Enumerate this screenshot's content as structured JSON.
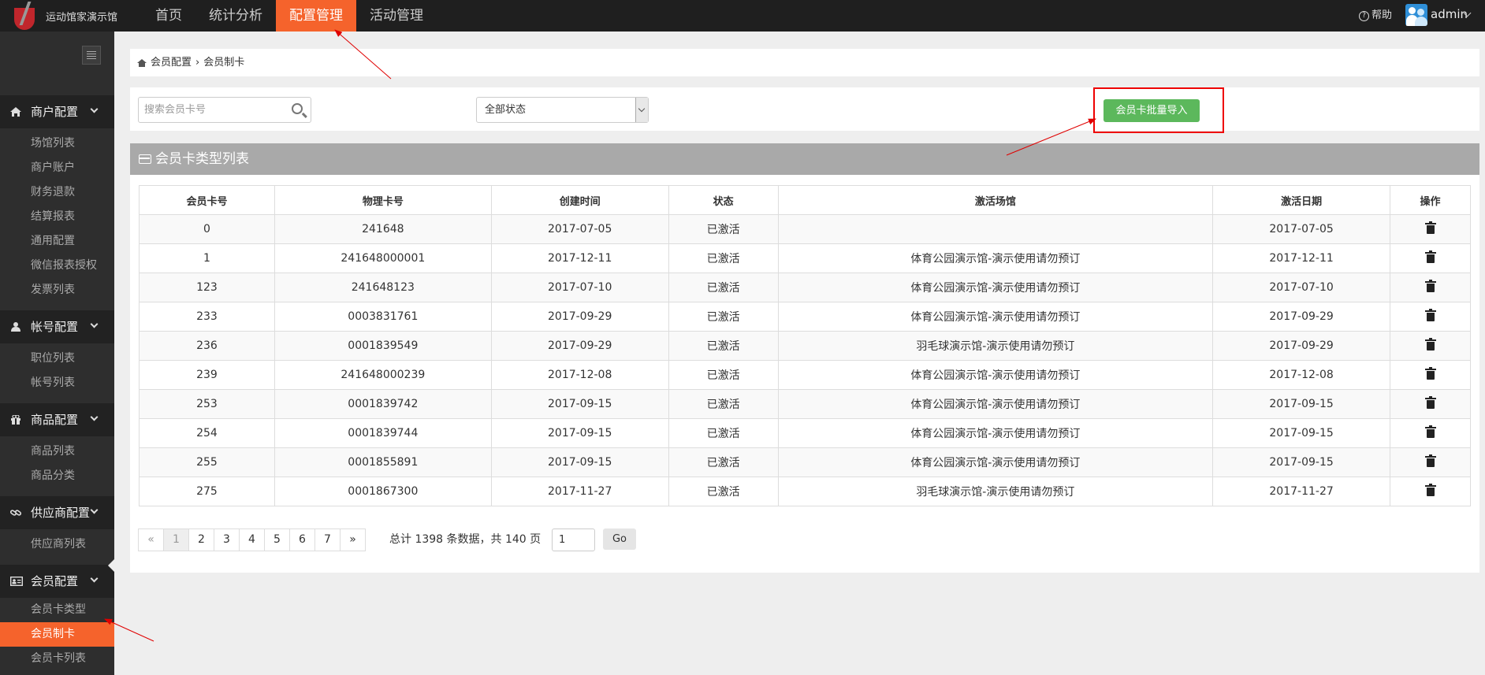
{
  "app": {
    "logo_text": "运动馆家演示馆",
    "help": "帮助",
    "user": "admin"
  },
  "nav": [
    {
      "label": "首页"
    },
    {
      "label": "统计分析"
    },
    {
      "label": "配置管理",
      "active": true
    },
    {
      "label": "活动管理"
    }
  ],
  "sidebar": {
    "sections": [
      {
        "label": "商户配置",
        "icon": "home-icon",
        "items": [
          "场馆列表",
          "商户账户",
          "财务退款",
          "结算报表",
          "通用配置",
          "微信报表授权",
          "发票列表"
        ]
      },
      {
        "label": "帐号配置",
        "icon": "user-icon",
        "items": [
          "职位列表",
          "帐号列表"
        ]
      },
      {
        "label": "商品配置",
        "icon": "gift-icon",
        "items": [
          "商品列表",
          "商品分类"
        ]
      },
      {
        "label": "供应商配置",
        "icon": "link-icon",
        "items": [
          "供应商列表"
        ]
      },
      {
        "label": "会员配置",
        "icon": "id-card-icon",
        "items": [
          "会员卡类型",
          "会员制卡",
          "会员卡列表"
        ]
      }
    ],
    "active_item": "会员制卡"
  },
  "breadcrumb": {
    "parent": "会员配置",
    "separator": "›",
    "current": "会员制卡"
  },
  "filter": {
    "search_placeholder": "搜索会员卡号",
    "status_value": "全部状态",
    "import_label": "会员卡批量导入"
  },
  "panel": {
    "title": "会员卡类型列表"
  },
  "table": {
    "headers": [
      "会员卡号",
      "物理卡号",
      "创建时间",
      "状态",
      "激活场馆",
      "激活日期",
      "操作"
    ],
    "rows": [
      [
        "0",
        "241648",
        "2017-07-05",
        "已激活",
        "",
        "2017-07-05"
      ],
      [
        "1",
        "241648000001",
        "2017-12-11",
        "已激活",
        "体育公园演示馆-演示使用请勿预订",
        "2017-12-11"
      ],
      [
        "123",
        "241648123",
        "2017-07-10",
        "已激活",
        "体育公园演示馆-演示使用请勿预订",
        "2017-07-10"
      ],
      [
        "233",
        "0003831761",
        "2017-09-29",
        "已激活",
        "体育公园演示馆-演示使用请勿预订",
        "2017-09-29"
      ],
      [
        "236",
        "0001839549",
        "2017-09-29",
        "已激活",
        "羽毛球演示馆-演示使用请勿预订",
        "2017-09-29"
      ],
      [
        "239",
        "241648000239",
        "2017-12-08",
        "已激活",
        "体育公园演示馆-演示使用请勿预订",
        "2017-12-08"
      ],
      [
        "253",
        "0001839742",
        "2017-09-15",
        "已激活",
        "体育公园演示馆-演示使用请勿预订",
        "2017-09-15"
      ],
      [
        "254",
        "0001839744",
        "2017-09-15",
        "已激活",
        "体育公园演示馆-演示使用请勿预订",
        "2017-09-15"
      ],
      [
        "255",
        "0001855891",
        "2017-09-15",
        "已激活",
        "体育公园演示馆-演示使用请勿预订",
        "2017-09-15"
      ],
      [
        "275",
        "0001867300",
        "2017-11-27",
        "已激活",
        "羽毛球演示馆-演示使用请勿预订",
        "2017-11-27"
      ]
    ],
    "action_icon": "trash-icon"
  },
  "pagination": {
    "prev": "«",
    "next": "»",
    "pages": [
      "1",
      "2",
      "3",
      "4",
      "5",
      "6",
      "7"
    ],
    "current": "1",
    "summary": "总计 1398 条数据，共 140 页",
    "goto_value": "1",
    "go_label": "Go"
  },
  "colors": {
    "accent": "#f5632c",
    "topbar": "#1f1f1f",
    "sidebar": "#2e2e2e",
    "import_button": "#5cb85c",
    "annotation": "#e00000"
  }
}
